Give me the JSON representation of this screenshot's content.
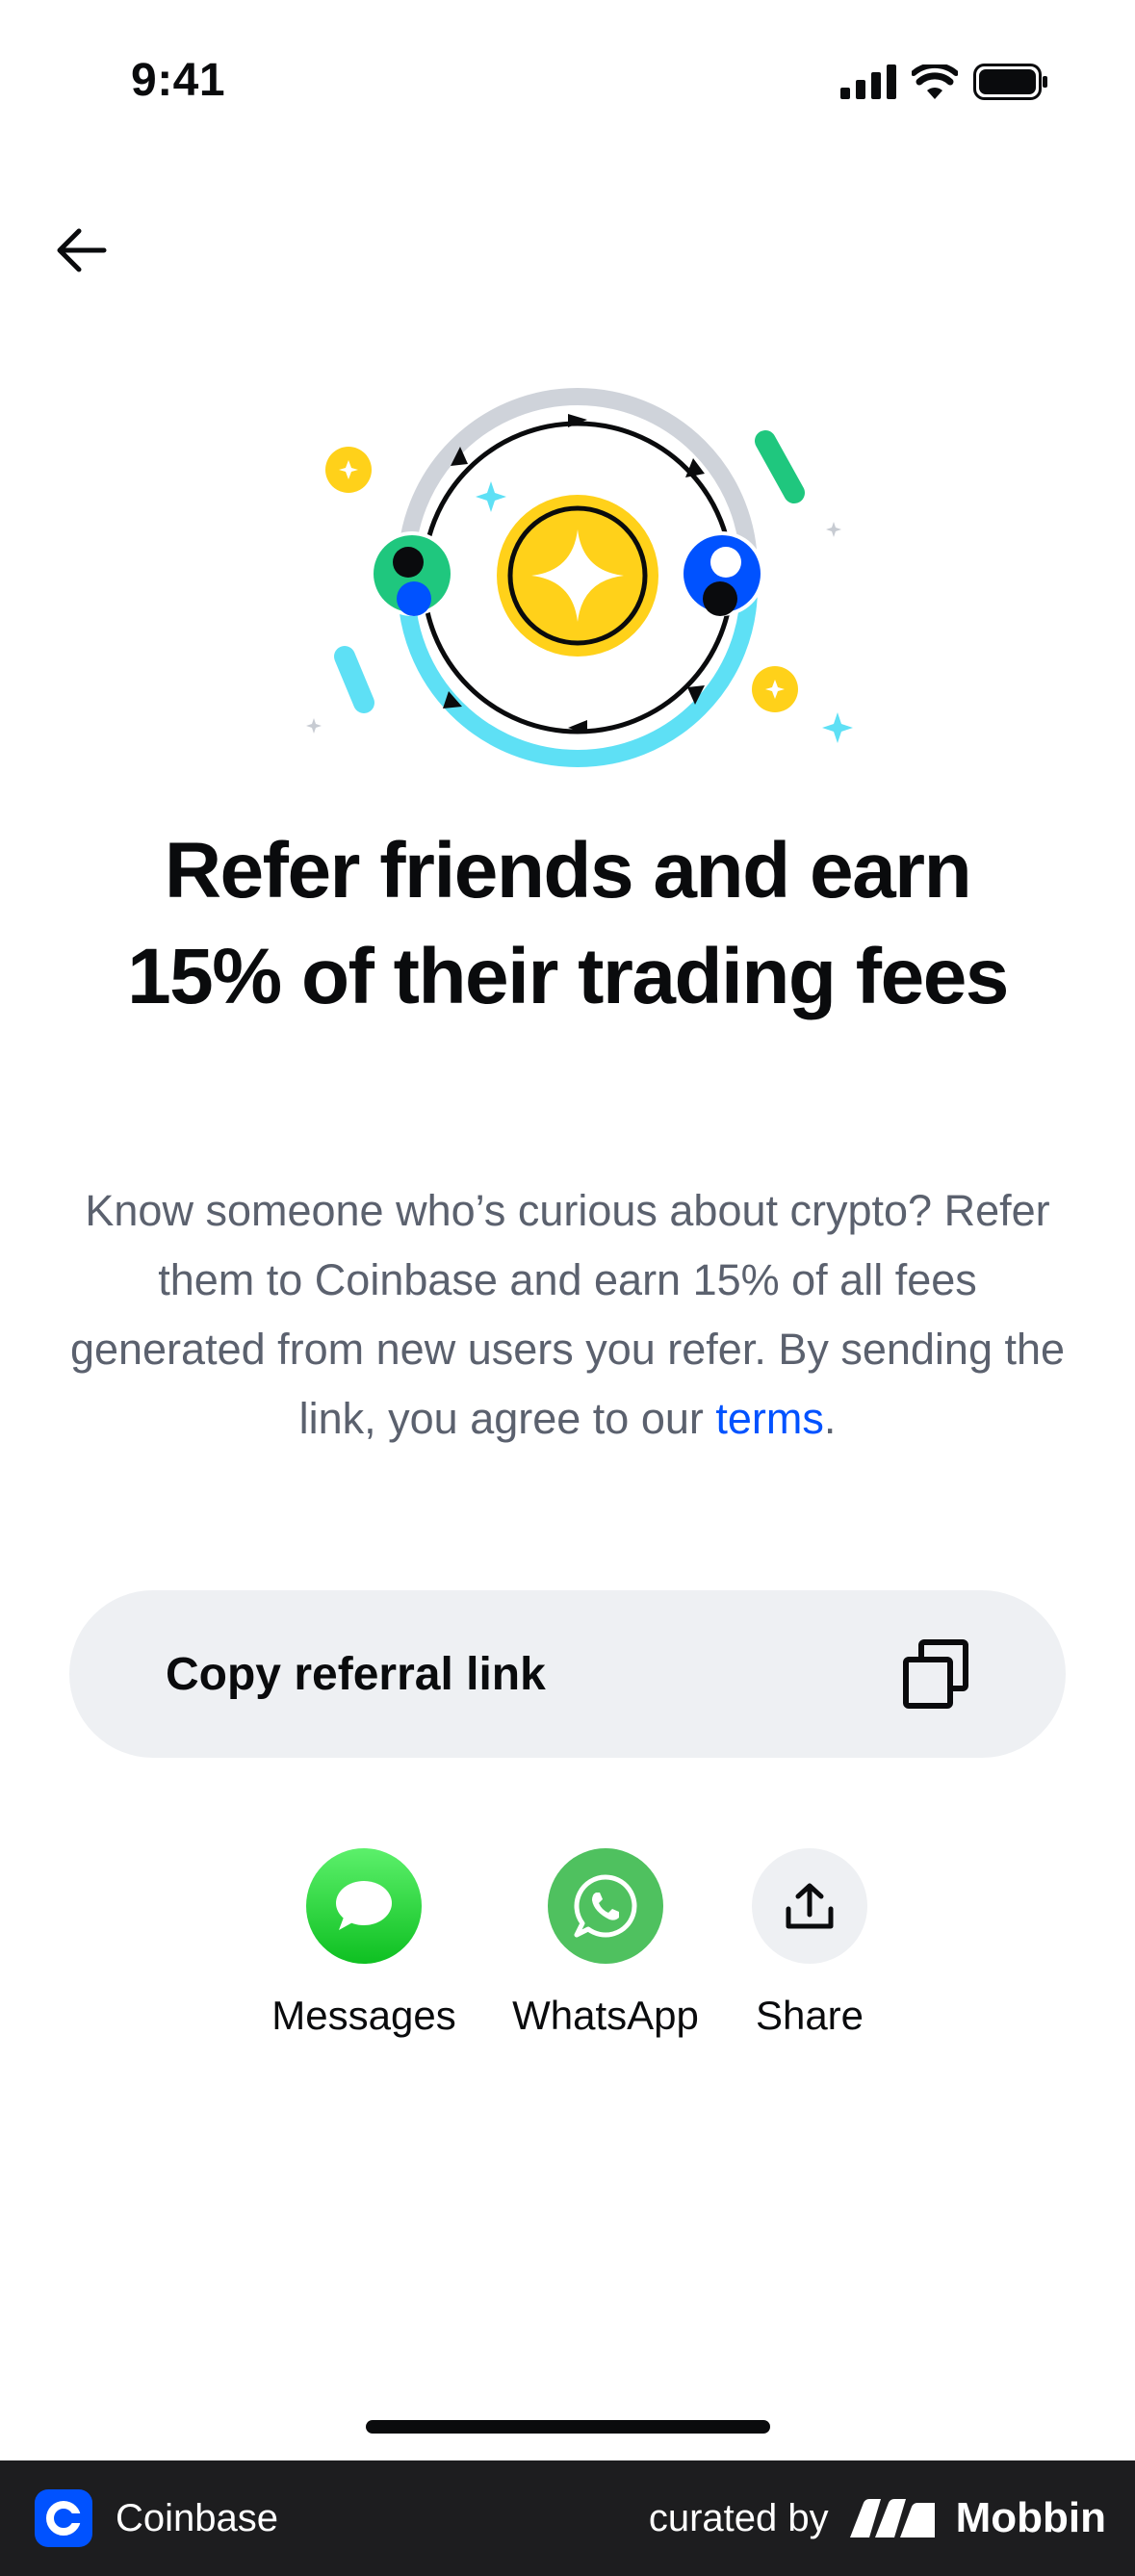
{
  "status_bar": {
    "time": "9:41"
  },
  "hero": {
    "title": "Refer friends and earn 15% of their trading fees"
  },
  "description": {
    "text": "Know someone who’s curious about crypto? Refer them to Coinbase and earn 15% of all fees generated from new users you refer. By sending the link, you agree to our ",
    "link_text": "terms",
    "trailing": "."
  },
  "copy_link": {
    "label": "Copy referral link"
  },
  "share_options": [
    {
      "label": "Messages",
      "icon": "message-bubble-icon",
      "color": "#22c33b"
    },
    {
      "label": "WhatsApp",
      "icon": "whatsapp-icon",
      "color": "#4fc15f"
    },
    {
      "label": "Share",
      "icon": "share-upload-icon",
      "color": "#eef0f3"
    }
  ],
  "footer": {
    "app_name": "Coinbase",
    "curated_by": "curated by",
    "brand": "Mobbin"
  },
  "colors": {
    "accent": "#0052ff",
    "gold": "#ffd11a",
    "cyan": "#5ee0f5",
    "green": "#1fc77e"
  }
}
